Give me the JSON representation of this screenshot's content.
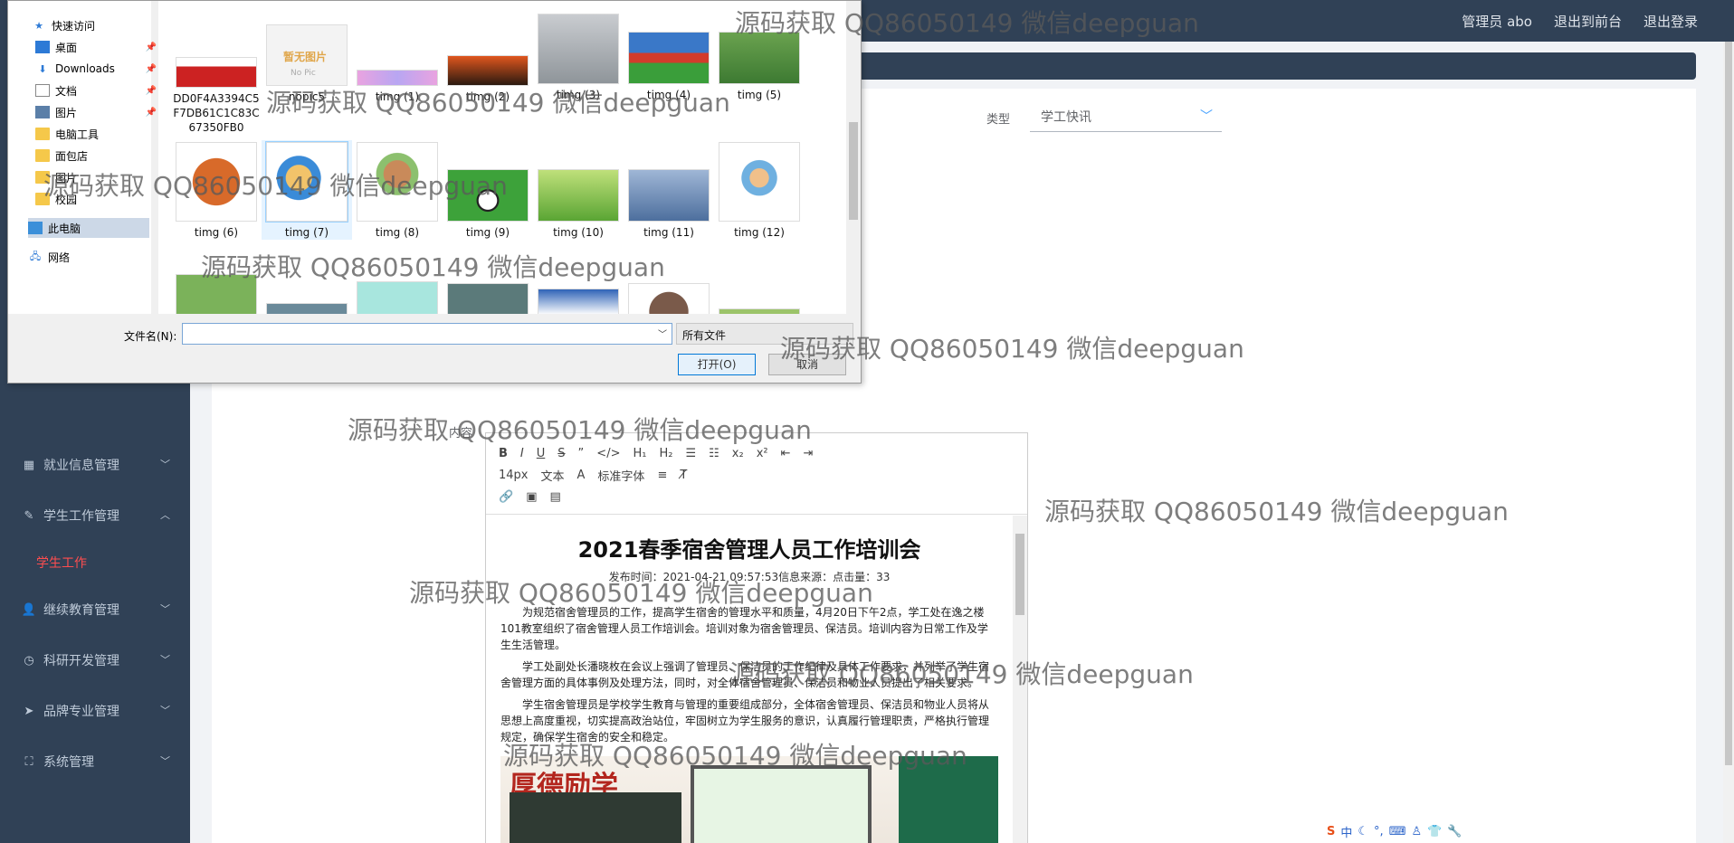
{
  "header": {
    "admin_label": "管理员 abo",
    "back_front": "退出到前台",
    "logout": "退出登录"
  },
  "sidebar": {
    "items": [
      {
        "label": "就业信息管理",
        "icon": "grid-icon"
      },
      {
        "label": "学生工作管理",
        "icon": "edit-icon"
      },
      {
        "label": "学生工作",
        "icon": ""
      },
      {
        "label": "继续教育管理",
        "icon": "user-icon"
      },
      {
        "label": "科研开发管理",
        "icon": "clock-icon"
      },
      {
        "label": "品牌专业管理",
        "icon": "send-icon"
      },
      {
        "label": "系统管理",
        "icon": "expand-icon"
      }
    ]
  },
  "form": {
    "type_label": "类型",
    "type_value": "学工快讯",
    "content_label": "内容"
  },
  "editor": {
    "toolbar_row1": [
      "B",
      "I",
      "U",
      "S",
      "”",
      "</>",
      "H₁",
      "H₂",
      "☰",
      "☷",
      "x₂",
      "x²",
      "⇤",
      "⇥"
    ],
    "toolbar_row2": [
      "14px",
      "文本",
      "标准字体"
    ],
    "title": "2021春季宿舍管理人员工作培训会",
    "meta": "发布时间：2021-04-21 09:57:53信息来源：点击量：33",
    "para1": "为规范宿舍管理员的工作，提高学生宿舍的管理水平和质量，4月20日下午2点，学工处在逸之楼101教室组织了宿舍管理人员工作培训会。培训对象为宿舍管理员、保洁员。培训内容为日常工作及学生生活管理。",
    "para2": "学工处副处长潘晓枚在会议上强调了管理员、保洁员的工作纪律及具体工作要求，并列举了学生宿舍管理方面的具体事例及处理方法，同时，对全体宿舍管理员、保洁员和物业人员提出了相关要求。",
    "para3": "学生宿舍管理员是学校学生教育与管理的重要组成部分，全体宿舍管理员、保洁员和物业人员将从思想上高度重视，切实提高政治站位，牢固树立为学生服务的意识，认真履行管理职责，严格执行管理规定，确保学生宿舍的安全和稳定。",
    "image_text": "厚德励学"
  },
  "dialog": {
    "nav": [
      {
        "label": "快速访问",
        "icon": "star-icon"
      },
      {
        "label": "桌面",
        "icon": "desktop-icon",
        "pinned": true
      },
      {
        "label": "Downloads",
        "icon": "download-icon",
        "pinned": true
      },
      {
        "label": "文档",
        "icon": "document-icon",
        "pinned": true
      },
      {
        "label": "图片",
        "icon": "picture-icon",
        "pinned": true
      },
      {
        "label": "电脑工具",
        "icon": "folder-icon"
      },
      {
        "label": "面包店",
        "icon": "folder-icon"
      },
      {
        "label": "图片",
        "icon": "folder-icon"
      },
      {
        "label": "校园",
        "icon": "folder-icon"
      },
      {
        "label": "此电脑",
        "icon": "computer-icon"
      },
      {
        "label": "网络",
        "icon": "network-icon"
      }
    ],
    "files_row1": [
      "DD0F4A3394C5F7DB61C1C83C67350FB0",
      "nopic5",
      "timg (1)",
      "timg (2)",
      "timg (3)",
      "timg (4)",
      "timg (5)"
    ],
    "files_row2": [
      "timg (6)",
      "timg (7)",
      "timg (8)",
      "timg (9)",
      "timg (10)",
      "timg (11)",
      "timg (12)"
    ],
    "nopic_text": "暂无图片",
    "nopic_sub": "No Pic",
    "filename_label": "文件名(N):",
    "filename_value": "",
    "filetype": "所有文件",
    "open_button": "打开(O)",
    "cancel_button": "取消"
  },
  "ime": {
    "brand": "S",
    "mode": "中"
  },
  "watermark": "源码获取 QQ86050149 微信deepguan",
  "colors": {
    "sidebar_bg": "#304156",
    "active_menu": "#ff4d4f",
    "accent": "#409eff"
  }
}
